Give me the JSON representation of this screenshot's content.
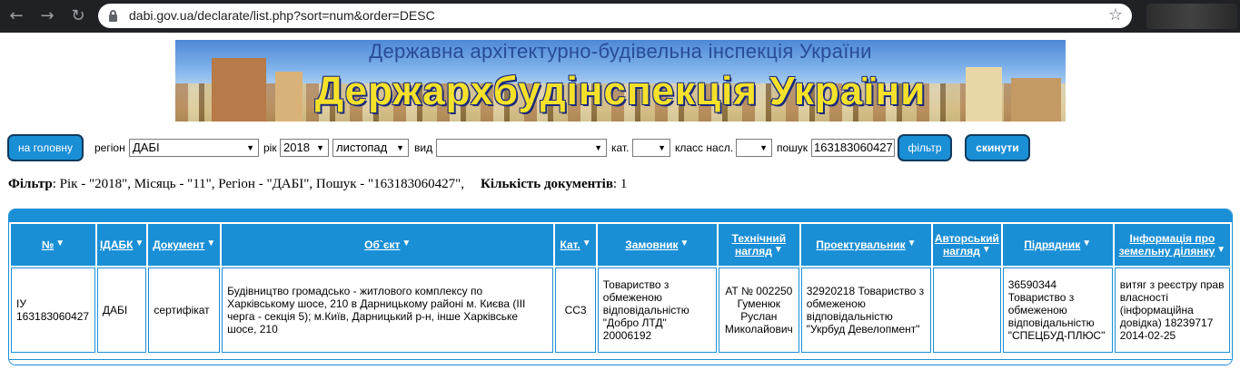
{
  "browser": {
    "url": "dabi.gov.ua/declarate/list.php?sort=num&order=DESC"
  },
  "banner": {
    "subtitle": "Державна архітектурно-будівельна інспекція України",
    "title": "Держархбудінспекція України"
  },
  "filters": {
    "home_label": "на головну",
    "region_label": "регіон",
    "region_value": "ДАБІ",
    "year_label": "рік",
    "year_value": "2018",
    "month_value": "листопад",
    "type_label": "вид",
    "type_value": "",
    "cat_label": "кат.",
    "cat_value": "",
    "class_label": "класс насл.",
    "class_value": "",
    "search_label": "пошук",
    "search_value": "163183060427",
    "filter_button": "фільтр",
    "reset_button": "скинути"
  },
  "summary": {
    "filter_label": "Фільтр",
    "filter_text": ": Рік - \"2018\", Місяць - \"11\", Регіон - \"ДАБІ\", Пошук - \"163183060427\",",
    "count_label": "Кількість документів",
    "count_text": ": 1"
  },
  "table": {
    "headers": [
      {
        "line1": "№",
        "line2": ""
      },
      {
        "line1": "ІДАБК",
        "line2": ""
      },
      {
        "line1": "Документ",
        "line2": ""
      },
      {
        "line1": "Об`єкт",
        "line2": ""
      },
      {
        "line1": "Кат.",
        "line2": ""
      },
      {
        "line1": "Замовник",
        "line2": ""
      },
      {
        "line1": "Технічний",
        "line2": "нагляд"
      },
      {
        "line1": "Проектувальник",
        "line2": ""
      },
      {
        "line1": "Авторський",
        "line2": "нагляд"
      },
      {
        "line1": "Підрядник",
        "line2": ""
      },
      {
        "line1": "Інформація про",
        "line2": "земельну ділянку"
      }
    ],
    "rows": [
      {
        "num": "ІУ 163183060427",
        "idabk": "ДАБІ",
        "document": "сертифікат",
        "object": "Будівництво громадсько - житлового комплексу по Харківському шосе, 210 в Дарницькому районі м. Києва (ІІІ черга - секція 5); м.Київ, Дарницький р-н, інше Харківське шосе, 210",
        "cat": "СС3",
        "customer": "Товариство з обмеженою відповідальністю \"Добро ЛТД\" 20006192",
        "tech_supervision": "АТ № 002250 Гуменюк Руслан Миколайович",
        "designer": "32920218 Товариство з обмеженою відповідальністю \"Укрбуд Девелопмент\"",
        "author_supervision": "",
        "contractor": "36590344 Товариство з обмеженою відповідальністю \"СПЕЦБУД-ПЛЮС\"",
        "land_info": "витяг з реєстру прав власності (інформаційна довідка) 18239717 2014-02-25"
      }
    ]
  }
}
